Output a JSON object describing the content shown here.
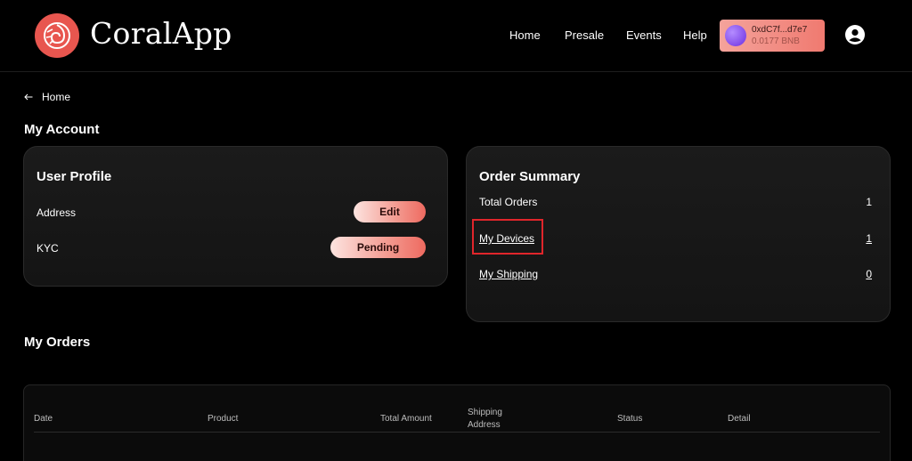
{
  "header": {
    "logo_text": "CoralApp",
    "nav": [
      "Home",
      "Presale",
      "Events",
      "Help"
    ],
    "wallet": {
      "address": "0xdC7f...d7e7",
      "balance": "0.0177 BNB"
    }
  },
  "breadcrumb": {
    "back_label": "Home"
  },
  "page_title": "My Account",
  "profile": {
    "title": "User Profile",
    "rows": [
      {
        "label": "Address",
        "action": "Edit"
      },
      {
        "label": "KYC",
        "action": "Pending"
      }
    ]
  },
  "order_summary": {
    "title": "Order Summary",
    "rows": [
      {
        "label": "Total Orders",
        "value": "1"
      },
      {
        "label": "My Devices",
        "value": "1"
      },
      {
        "label": "My Shipping",
        "value": "0"
      }
    ]
  },
  "orders": {
    "title": "My Orders",
    "columns": [
      "Date",
      "Product",
      "Total Amount",
      "Shipping\nAddress",
      "Status",
      "Detail"
    ]
  },
  "colors": {
    "accent": "#e8564f",
    "highlight": "#e0252b"
  }
}
